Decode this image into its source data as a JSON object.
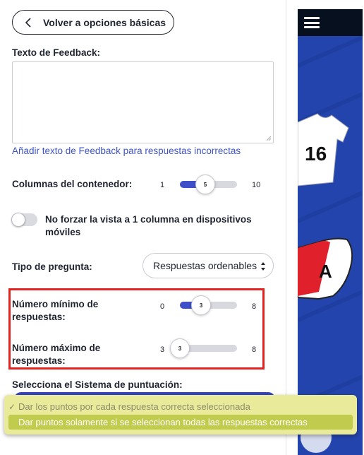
{
  "back_button": {
    "label": "Volver a opciones básicas"
  },
  "feedback": {
    "label": "Texto de Feedback:",
    "value": "",
    "add_incorrect_link": "Añadir texto de Feedback para respuestas incorrectas"
  },
  "columns": {
    "label": "Columnas del contenedor:",
    "min": "1",
    "max": "10",
    "value": "5",
    "fraction": 0.4444
  },
  "mobile_toggle": {
    "label_line1": "No forzar la vista a 1 columna en dispositivos",
    "label_line2": "móviles",
    "checked": false
  },
  "question_type": {
    "label": "Tipo de pregunta:",
    "selected": "Respuestas ordenables"
  },
  "min_answers": {
    "label_line1": "Número mínimo de",
    "label_line2": "respuestas:",
    "min": "0",
    "max": "8",
    "value": "3",
    "fraction": 0.375
  },
  "max_answers": {
    "label_line1": "Número máximo de",
    "label_line2": "respuestas:",
    "min": "3",
    "max": "8",
    "value": "3",
    "fraction": 0.0
  },
  "scoring": {
    "label": "Selecciona el Sistema de puntuación:",
    "options": [
      {
        "label": "Dar los puntos por cada respuesta correcta seleccionada",
        "check": "✓"
      },
      {
        "label": "Dar puntos solamente si se seleccionan todas las respuestas correctas",
        "check": ""
      }
    ]
  },
  "colors": {
    "accent": "#3e4fc9",
    "link": "#3e54c4",
    "highlight": "#e3231f",
    "dropdown_bg": "#e9ea9a",
    "dropdown_active": "#c1cc4f",
    "preview_bg": "#1f3fa6"
  },
  "icons": {
    "back": "chevron-left-icon",
    "menu": "hamburger-icon",
    "select": "updown-arrows-icon"
  }
}
